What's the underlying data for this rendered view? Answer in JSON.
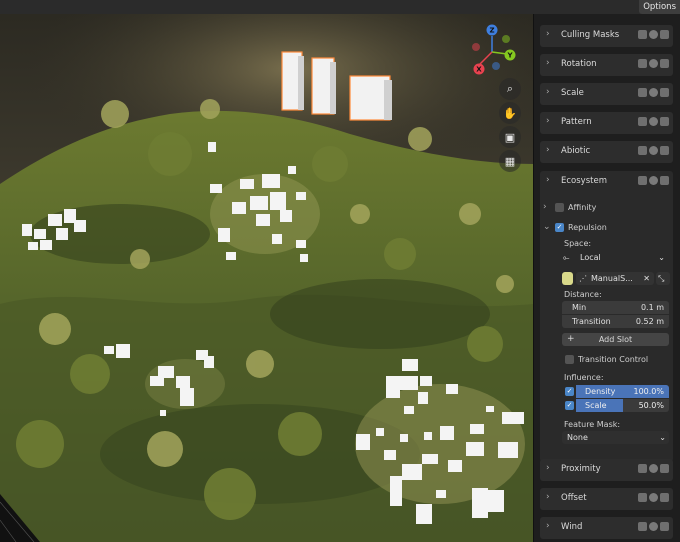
{
  "topbar": {
    "options_label": "Options"
  },
  "panel": {
    "sections_top": [
      {
        "label": "Culling Masks"
      },
      {
        "label": "Rotation"
      },
      {
        "label": "Scale"
      },
      {
        "label": "Pattern"
      },
      {
        "label": "Abiotic"
      }
    ],
    "ecosystem": {
      "label": "Ecosystem",
      "affinity_label": "Affinity",
      "repulsion_label": "Repulsion",
      "space_label": "Space:",
      "space_value": "Local",
      "slot_name": "ManualS...",
      "distance_label": "Distance:",
      "min_label": "Min",
      "min_value": "0.1 m",
      "transition_label": "Transition",
      "transition_value": "0.52 m",
      "add_slot_label": "Add Slot",
      "transition_control_label": "Transition Control",
      "influence_label": "Influence:",
      "density_label": "Density",
      "density_value": "100.0%",
      "density_fraction": 1.0,
      "scale_label": "Scale",
      "scale_value": "50.0%",
      "scale_fraction": 0.5,
      "feature_mask_label": "Feature Mask:",
      "feature_mask_value": "None"
    },
    "sections_bottom": [
      {
        "label": "Proximity"
      },
      {
        "label": "Offset"
      },
      {
        "label": "Wind"
      }
    ]
  },
  "gizmo": {
    "z": "Z",
    "y": "Y",
    "x": "X"
  },
  "colors": {
    "accent": "#4a86c8",
    "x_axis": "#e8424f",
    "y_axis": "#85c820",
    "z_axis": "#3e7fe0"
  }
}
